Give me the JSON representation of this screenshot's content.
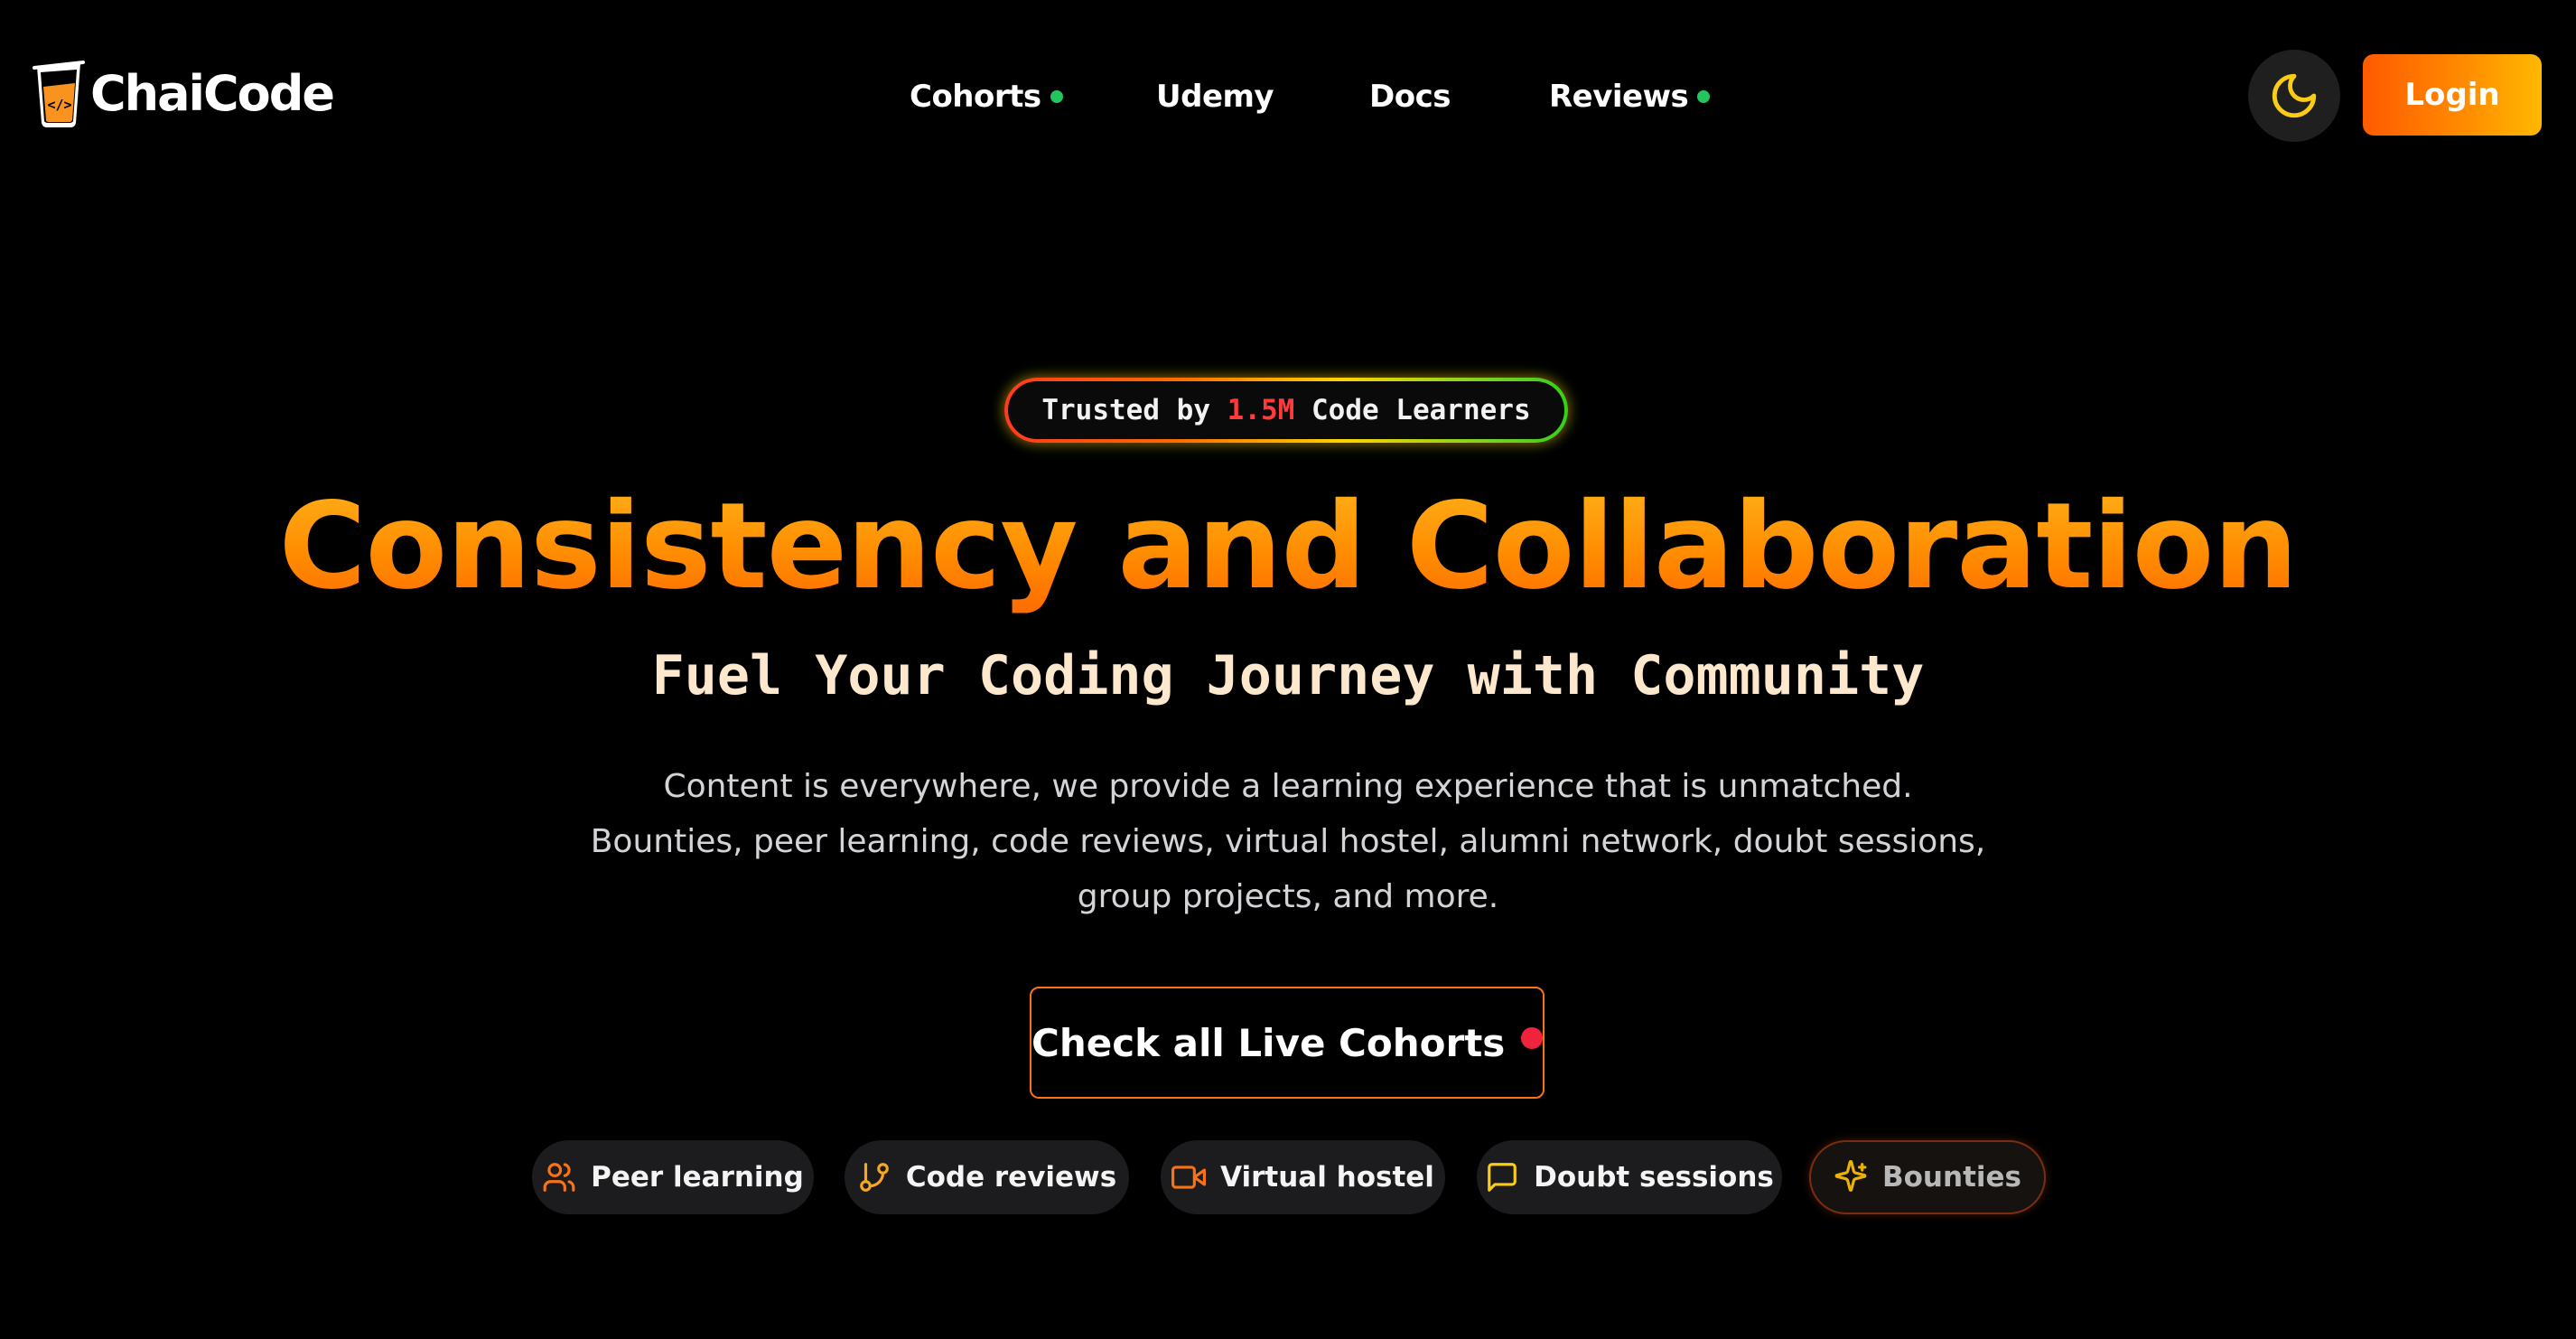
{
  "header": {
    "logo_text": "ChaiCode",
    "nav": [
      {
        "label": "Cohorts",
        "has_dot": true
      },
      {
        "label": "Udemy",
        "has_dot": false
      },
      {
        "label": "Docs",
        "has_dot": false
      },
      {
        "label": "Reviews",
        "has_dot": true
      }
    ],
    "theme_icon": "moon-icon",
    "login_label": "Login"
  },
  "badge": {
    "prefix": "Trusted by ",
    "count": "1.5M",
    "suffix": " Code Learners"
  },
  "hero": {
    "title": "Consistency and Collaboration",
    "subtitle": "Fuel Your Coding Journey with Community",
    "description_lines": [
      "Content is everywhere, we provide a learning experience that is unmatched.",
      "Bounties, peer learning, code reviews, virtual hostel, alumni network, doubt sessions,",
      "group projects, and more."
    ]
  },
  "cta": {
    "label": "Check all Live Cohorts"
  },
  "features": [
    {
      "label": "Peer learning",
      "icon": "users-icon"
    },
    {
      "label": "Code reviews",
      "icon": "git-branch-icon"
    },
    {
      "label": "Virtual hostel",
      "icon": "video-icon"
    },
    {
      "label": "Doubt sessions",
      "icon": "message-square-icon"
    },
    {
      "label": "Bounties",
      "icon": "sparkles-icon"
    }
  ],
  "colors": {
    "background": "#000000",
    "accent_orange": "#f97316",
    "nav_dot_green": "#22c55e",
    "live_dot_red": "#ef233c",
    "moon_yellow": "#facc15"
  }
}
